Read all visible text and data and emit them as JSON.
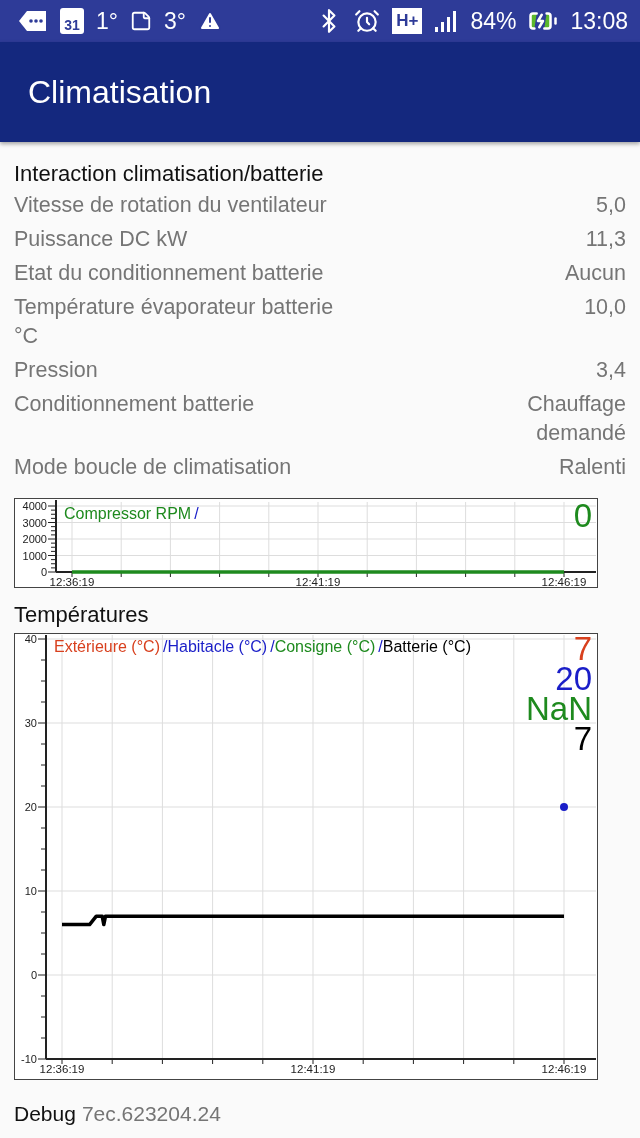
{
  "status_bar": {
    "calendar_day": "31",
    "weather_1": "1°",
    "weather_2": "3°",
    "network": "H+",
    "battery": "84%",
    "time": "13:08"
  },
  "app_bar": {
    "title": "Climatisation"
  },
  "section": {
    "title": "Interaction climatisation/batterie",
    "rows": [
      {
        "label": "Vitesse de rotation du ventilateur",
        "value": "5,0"
      },
      {
        "label": "Puissance DC kW",
        "value": "11,3"
      },
      {
        "label": "Etat du conditionnement batterie",
        "value": "Aucun"
      },
      {
        "label": "Température évaporateur batterie °C",
        "value": "10,0"
      },
      {
        "label": "Pression",
        "value": "3,4"
      },
      {
        "label": "Conditionnement batterie",
        "value": "Chauffage demandé"
      },
      {
        "label": "Mode boucle de climatisation",
        "value": "Ralenti"
      }
    ]
  },
  "compressor_chart": {
    "separator": "/",
    "readings": [
      "0"
    ],
    "chart_data": {
      "type": "line",
      "grid": true,
      "x": [
        45379,
        45979
      ],
      "xlim": [
        45379,
        45979
      ],
      "ylim": [
        0,
        4000
      ],
      "yticks": [
        0,
        1000,
        2000,
        3000,
        4000
      ],
      "xticks": [
        {
          "value": 45379,
          "label": "12:36:19"
        },
        {
          "value": 45679,
          "label": "12:41:19"
        },
        {
          "value": 45979,
          "label": "12:46:19"
        }
      ],
      "series": [
        {
          "name": "Compressor RPM",
          "color": "#1e8a1e",
          "values": [
            0,
            0
          ]
        }
      ]
    }
  },
  "temperatures": {
    "title": "Températures",
    "separator": "/",
    "readings": [
      "7",
      "20",
      "NaN",
      "7"
    ],
    "chart_data": {
      "type": "line",
      "grid": true,
      "x": [
        45379,
        45412,
        45420,
        45427,
        45429,
        45431,
        45439,
        45499,
        45559,
        45619,
        45679,
        45739,
        45799,
        45859,
        45919,
        45979
      ],
      "xlim": [
        45379,
        45979
      ],
      "ylim": [
        -10,
        40
      ],
      "yticks": [
        -10,
        0,
        10,
        20,
        30,
        40
      ],
      "xticks": [
        {
          "value": 45379,
          "label": "12:36:19"
        },
        {
          "value": 45679,
          "label": "12:41:19"
        },
        {
          "value": 45979,
          "label": "12:46:19"
        }
      ],
      "series": [
        {
          "name": "Extérieure (°C)",
          "color": "#d8401e",
          "values": [
            null,
            null,
            null,
            null,
            null,
            null,
            null,
            null,
            null,
            null,
            null,
            null,
            null,
            null,
            null,
            null
          ]
        },
        {
          "name": "Habitacle (°C)",
          "color": "#1a1ec8",
          "marker": "o",
          "values": [
            null,
            null,
            null,
            null,
            null,
            null,
            null,
            null,
            null,
            null,
            null,
            null,
            null,
            null,
            null,
            20
          ]
        },
        {
          "name": "Consigne (°C)",
          "color": "#1e8a1e",
          "values": [
            null,
            null,
            null,
            null,
            null,
            null,
            null,
            null,
            null,
            null,
            null,
            null,
            null,
            null,
            null,
            null
          ]
        },
        {
          "name": "Batterie (°C)",
          "color": "#000000",
          "values": [
            6,
            6,
            7,
            7,
            6,
            7,
            7,
            7,
            7,
            7,
            7,
            7,
            7,
            7,
            7,
            7
          ]
        }
      ]
    }
  },
  "debug": {
    "label": "Debug",
    "value": "7ec.623204.24"
  }
}
